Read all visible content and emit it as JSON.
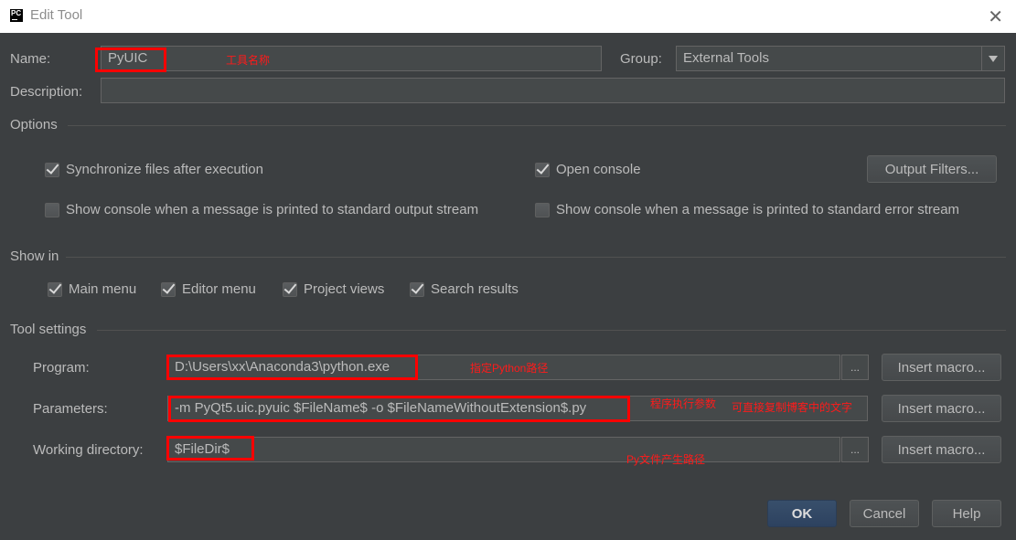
{
  "window": {
    "app_icon": "pycharm-icon",
    "app_icon_text": "PC",
    "title": "Edit Tool",
    "close_glyph": "✕"
  },
  "general": {
    "name_label": "Name:",
    "name_value": "PyUIC",
    "group_label": "Group:",
    "group_value": "External Tools",
    "description_label": "Description:",
    "description_value": ""
  },
  "options": {
    "section_title": "Options",
    "checkboxes": [
      {
        "label": "Synchronize files after execution",
        "checked": true
      },
      {
        "label": "Open console",
        "checked": true
      },
      {
        "label": "Show console when a message is printed to standard output stream",
        "checked": false
      },
      {
        "label": "Show console when a message is printed to standard error stream",
        "checked": false
      }
    ],
    "output_filters_button": "Output Filters..."
  },
  "show_in": {
    "section_title": "Show in",
    "checkboxes": [
      {
        "label": "Main menu",
        "checked": true
      },
      {
        "label": "Editor menu",
        "checked": true
      },
      {
        "label": "Project views",
        "checked": true
      },
      {
        "label": "Search results",
        "checked": true
      }
    ]
  },
  "tool_settings": {
    "section_title": "Tool settings",
    "program_label": "Program:",
    "program_value": "D:\\Users\\xx\\Anaconda3\\python.exe",
    "parameters_label": "Parameters:",
    "parameters_value": "-m PyQt5.uic.pyuic  $FileName$ -o $FileNameWithoutExtension$.py",
    "working_dir_label": "Working directory:",
    "working_dir_value": "$FileDir$",
    "browse_glyph": "...",
    "insert_macro_button": "Insert macro..."
  },
  "annotations": {
    "name_note": "工具名称",
    "program_note": "指定Python路径",
    "parameters_note": "程序执行参数",
    "copy_note": "可直接复制博客中的文字",
    "workdir_note": "Py文件产生路径",
    "color": "#ff0000"
  },
  "footer": {
    "ok": "OK",
    "cancel": "Cancel",
    "help": "Help"
  }
}
